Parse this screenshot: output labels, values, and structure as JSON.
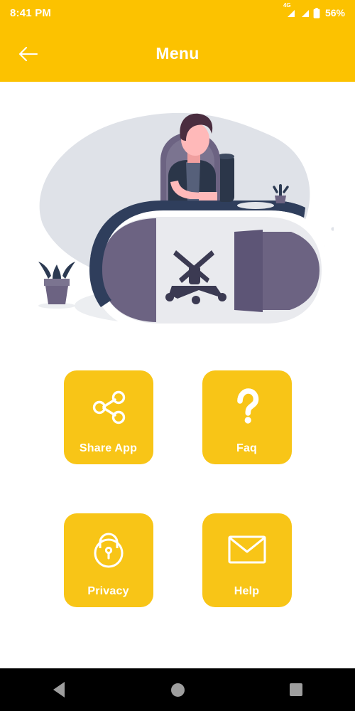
{
  "status_bar": {
    "time": "8:41 PM",
    "network_label": "4G",
    "battery_percent": "56%",
    "icons": [
      "signal-4g-icon",
      "signal-icon",
      "battery-icon"
    ]
  },
  "app_bar": {
    "title": "Menu",
    "back_icon": "arrow-left-icon"
  },
  "illustration": {
    "name": "person-at-desk-illustration",
    "alt": "Person sitting at a curved office desk with a plant and speaker"
  },
  "menu": {
    "items": [
      {
        "label": "Share App",
        "icon": "share-nodes-icon"
      },
      {
        "label": "Faq",
        "icon": "question-mark-icon"
      },
      {
        "label": "Privacy",
        "icon": "lock-icon"
      },
      {
        "label": "Help",
        "icon": "envelope-icon"
      }
    ]
  },
  "nav_bar": {
    "back": "back-triangle-icon",
    "home": "home-circle-icon",
    "recents": "recents-square-icon"
  },
  "colors": {
    "brand_yellow": "#FCC200",
    "card_yellow": "#F8C517",
    "on_brand": "#ffffff",
    "nav_bg": "#000000",
    "nav_icon": "#9e9e9e",
    "illustration_dark": "#2f3e5c",
    "illustration_purple": "#6c6382",
    "illustration_blob": "#dfe2e8",
    "skin": "#ffb9b9",
    "hair": "#4a2d3f"
  }
}
